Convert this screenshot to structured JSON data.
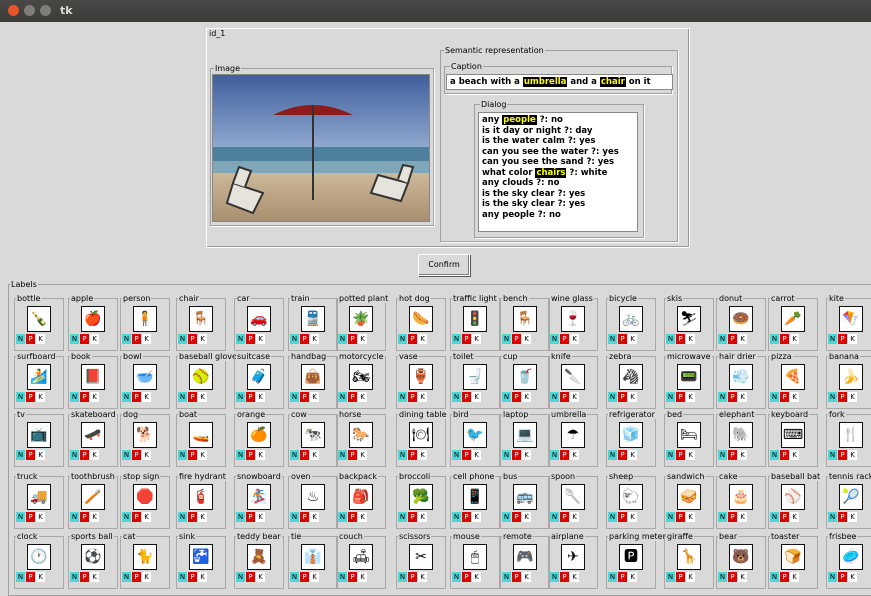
{
  "window": {
    "title": "tk"
  },
  "panel": {
    "id_label": "id_1",
    "image_label": "Image",
    "semantic_label": "Semantic representation",
    "caption_label": "Caption",
    "dialog_label": "Dialog"
  },
  "caption": {
    "pre": "a beach with a ",
    "h1": "umbrella",
    "mid": " and a ",
    "h2": "chair",
    "post": " on it"
  },
  "dialog": [
    {
      "pre": "any ",
      "hl": "people",
      "post": " ?:  no"
    },
    {
      "pre": "is it day or night ?:  day",
      "hl": "",
      "post": ""
    },
    {
      "pre": "is the water calm ?:  yes",
      "hl": "",
      "post": ""
    },
    {
      "pre": "can you see the water ?:  yes",
      "hl": "",
      "post": ""
    },
    {
      "pre": "can you see the sand ?:  yes",
      "hl": "",
      "post": ""
    },
    {
      "pre": "what color ",
      "hl": "chairs",
      "post": " ?:  white"
    },
    {
      "pre": "any clouds ?:  no",
      "hl": "",
      "post": ""
    },
    {
      "pre": "is the sky clear ?:  yes",
      "hl": "",
      "post": ""
    },
    {
      "pre": "is the sky clear ?:  yes",
      "hl": "",
      "post": ""
    },
    {
      "pre": "any people ?:  no",
      "hl": "",
      "post": ""
    }
  ],
  "confirm_label": "Confirm",
  "labels_title": "Labels",
  "btn": {
    "n": "N",
    "p": "P",
    "k": "K"
  },
  "labels": [
    [
      "bottle",
      "apple",
      "person",
      "chair",
      "car",
      "train",
      "potted plant",
      "hot dog",
      "traffic light",
      "bench",
      "wine glass",
      "bicycle",
      "skis",
      "donut",
      "carrot",
      "kite"
    ],
    [
      "surfboard",
      "book",
      "bowl",
      "baseball glove",
      "suitcase",
      "handbag",
      "motorcycle",
      "vase",
      "toilet",
      "cup",
      "knife",
      "zebra",
      "microwave",
      "hair drier",
      "pizza",
      "banana"
    ],
    [
      "tv",
      "skateboard",
      "dog",
      "boat",
      "orange",
      "cow",
      "horse",
      "dining table",
      "bird",
      "laptop",
      "umbrella",
      "refrigerator",
      "bed",
      "elephant",
      "keyboard",
      "fork"
    ],
    [
      "truck",
      "toothbrush",
      "stop sign",
      "fire hydrant",
      "snowboard",
      "oven",
      "backpack",
      "broccoli",
      "cell phone",
      "bus",
      "spoon",
      "sheep",
      "sandwich",
      "cake",
      "baseball bat",
      "tennis racket"
    ],
    [
      "clock",
      "sports ball",
      "cat",
      "sink",
      "teddy bear",
      "tie",
      "couch",
      "scissors",
      "mouse",
      "remote",
      "airplane",
      "parking meter",
      "giraffe",
      "bear",
      "toaster",
      "frisbee"
    ]
  ],
  "icons": [
    [
      "🍾",
      "🍎",
      "🧍",
      "🪑",
      "🚗",
      "🚆",
      "🪴",
      "🌭",
      "🚦",
      "🪑",
      "🍷",
      "🚲",
      "⛷",
      "🍩",
      "🥕",
      "🪁"
    ],
    [
      "🏄",
      "📕",
      "🥣",
      "🥎",
      "🧳",
      "👜",
      "🏍",
      "🏺",
      "🚽",
      "🥤",
      "🔪",
      "🦓",
      "📟",
      "💨",
      "🍕",
      "🍌"
    ],
    [
      "📺",
      "🛹",
      "🐕",
      "🚤",
      "🍊",
      "🐄",
      "🐎",
      "🍽",
      "🐦",
      "💻",
      "☂",
      "🧊",
      "🛏",
      "🐘",
      "⌨",
      "🍴"
    ],
    [
      "🚚",
      "🪥",
      "🛑",
      "🧯",
      "🏂",
      "♨",
      "🎒",
      "🥦",
      "📱",
      "🚌",
      "🥄",
      "🐑",
      "🥪",
      "🎂",
      "⚾",
      "🎾"
    ],
    [
      "🕐",
      "⚽",
      "🐈",
      "🚰",
      "🧸",
      "👔",
      "🛋",
      "✂",
      "🖱",
      "🎮",
      "✈",
      "🅿",
      "🦒",
      "🐻",
      "🍞",
      "🥏"
    ]
  ]
}
